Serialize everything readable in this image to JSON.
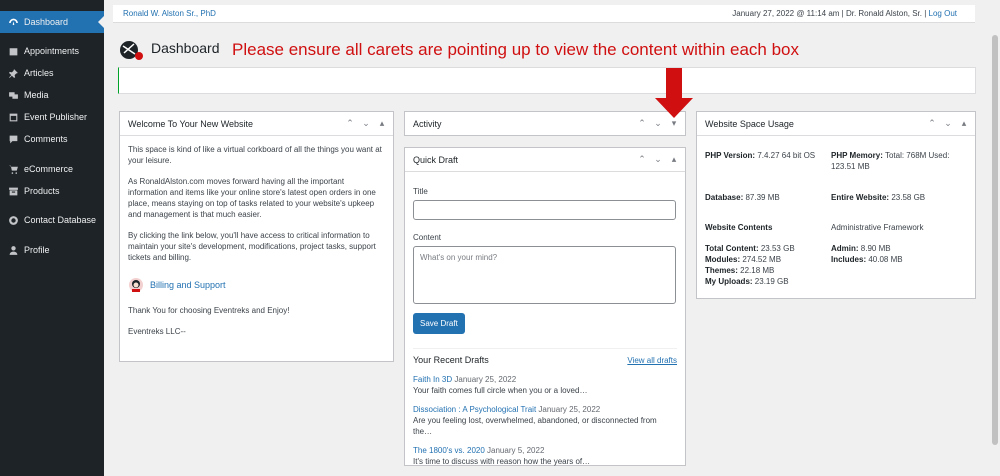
{
  "sidebar": {
    "items": [
      {
        "label": "Dashboard",
        "icon": "dashboard-icon"
      },
      {
        "label": "Appointments",
        "icon": "calendar-icon"
      },
      {
        "label": "Articles",
        "icon": "pin-icon"
      },
      {
        "label": "Media",
        "icon": "media-icon"
      },
      {
        "label": "Event Publisher",
        "icon": "event-icon"
      },
      {
        "label": "Comments",
        "icon": "comment-icon"
      },
      {
        "label": "eCommerce",
        "icon": "cart-icon"
      },
      {
        "label": "Products",
        "icon": "archive-icon"
      },
      {
        "label": "Contact Database",
        "icon": "circle-icon"
      },
      {
        "label": "Profile",
        "icon": "user-icon"
      }
    ]
  },
  "topbar": {
    "user_left": "Ronald W. Alston Sr., PhD",
    "datetime": "January 27, 2022 @ 11:14 am | Dr. Ronald Alston, Sr. |",
    "logout": "Log Out"
  },
  "header": {
    "title": "Dashboard",
    "notice": "Please ensure all carets are pointing up to view the content within each box"
  },
  "welcome": {
    "title": "Welcome To Your New Website",
    "p1": "This space is kind of like a virtual corkboard of all the things you want at your leisure.",
    "p2": "As RonaldAlston.com moves forward having all the important information and items like your online store's latest open orders in one place, means staying on top of tasks related to your website's upkeep and management is that much easier.",
    "p3": "By clicking the link below, you'll have access to critical information to maintain your site's development, modifications, project tasks, support tickets and billing.",
    "billing_link": "Billing and Support",
    "p4": "Thank You for choosing Eventreks and Enjoy!",
    "p5": "Eventreks LLC--"
  },
  "activity": {
    "title": "Activity"
  },
  "quick_draft": {
    "title": "Quick Draft",
    "title_label": "Title",
    "title_value": "",
    "content_label": "Content",
    "content_placeholder": "What's on your mind?",
    "save_label": "Save Draft",
    "recent_label": "Your Recent Drafts",
    "view_all": "View all drafts",
    "drafts": [
      {
        "title": "Faith In 3D",
        "date": "January 25, 2022",
        "excerpt": "Your faith comes full circle when you or a loved…"
      },
      {
        "title": "Dissociation : A Psychological Trait",
        "date": "January 25, 2022",
        "excerpt": "Are you feeling lost, overwhelmed, abandoned, or disconnected from the…"
      },
      {
        "title": "The 1800's vs. 2020",
        "date": "January 5, 2022",
        "excerpt": "It's time to discuss with reason how the years of…"
      }
    ]
  },
  "space": {
    "title": "Website Space Usage",
    "php_version_label": "PHP Version:",
    "php_version": "7.4.27 64 bit OS",
    "php_memory_label": "PHP Memory:",
    "php_memory": "Total: 768M Used: 123.51 MB",
    "database_label": "Database:",
    "database": "87.39 MB",
    "entire_label": "Entire Website:",
    "entire": "23.58 GB",
    "contents_label": "Website Contents",
    "admin_fw_label": "Administrative Framework",
    "total_label": "Total Content:",
    "total": "23.53 GB",
    "modules_label": "Modules:",
    "modules": "274.52 MB",
    "themes_label": "Themes:",
    "themes": "22.18 MB",
    "uploads_label": "My Uploads:",
    "uploads": "23.19 GB",
    "admin_label": "Admin:",
    "admin": "8.90 MB",
    "includes_label": "Includes:",
    "includes": "40.08 MB"
  },
  "colors": {
    "accent": "#2271b1",
    "sidebar": "#1d2327",
    "notice": "#d01010"
  }
}
